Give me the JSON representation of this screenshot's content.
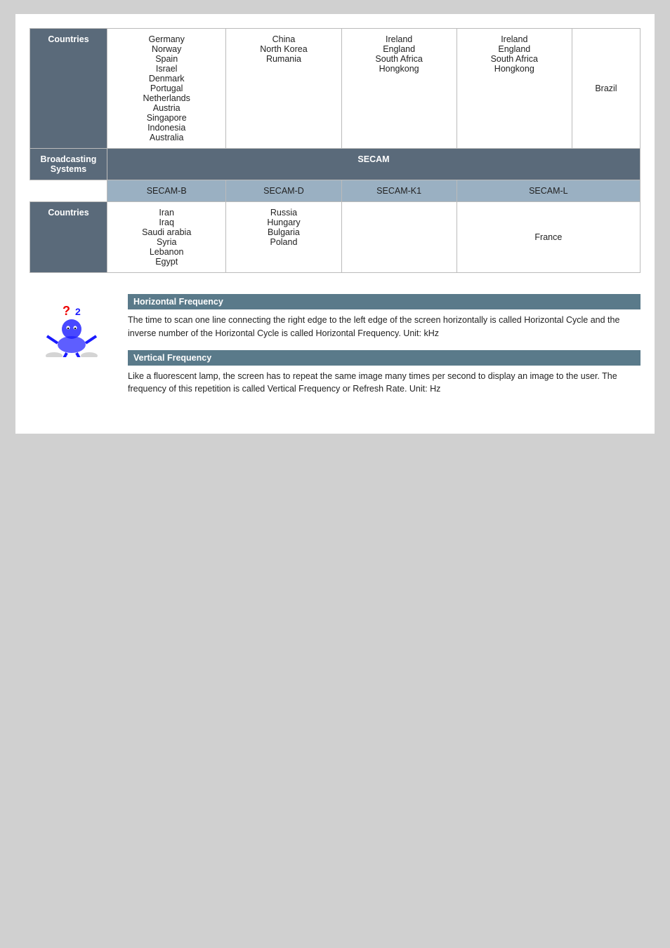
{
  "table": {
    "rows": [
      {
        "label": "Countries",
        "cols": [
          "Germany\nNorway\nSpain\nIsrael\nDenmark\nPortugal\nNetherlands\nAustria\nSingapore\nIndonesia\nAustralia",
          "China\nNorth Korea\nRumania",
          "Ireland\nEngland\nSouth Africa\nHongkong",
          "Ireland\nEngland\nSouth Africa\nHongkong",
          "Brazil"
        ]
      },
      {
        "label": "Broadcasting Systems",
        "isHeader": true,
        "headerText": "SECAM",
        "subHeaders": [
          "SECAM-B",
          "SECAM-D",
          "SECAM-K1",
          "SECAM-L"
        ]
      },
      {
        "label": "Countries",
        "cols": [
          "Iran\nIraq\nSaudi arabia\nSyria\nLebanon\nEgypt",
          "Russia\nHungary\nBulgaria\nPoland",
          "",
          "France"
        ]
      }
    ]
  },
  "info": {
    "horizontal_frequency": {
      "title": "Horizontal Frequency",
      "text": "The time to scan one line connecting the right edge to the left edge of the screen horizontally is called Horizontal Cycle and the inverse number of the Horizontal Cycle is called Horizontal Frequency. Unit: kHz"
    },
    "vertical_frequency": {
      "title": "Vertical Frequency",
      "text": "Like a fluorescent lamp, the screen has to repeat the same image many times per second to display an image to the user. The frequency of this repetition is called Vertical Frequency or Refresh Rate. Unit: Hz"
    }
  }
}
